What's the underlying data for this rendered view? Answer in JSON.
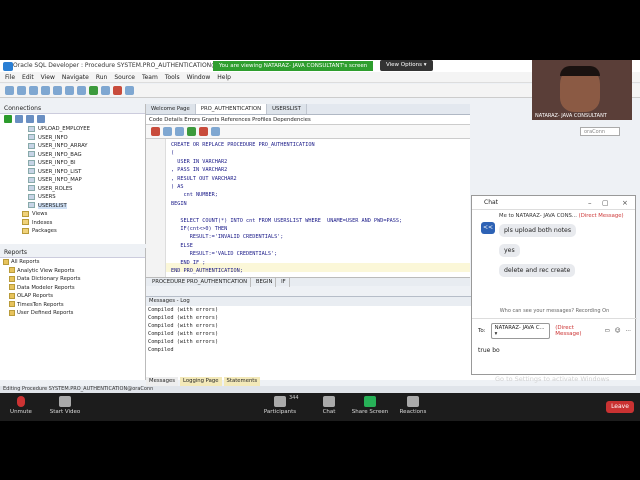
{
  "app": {
    "title": "Oracle SQL Developer : Procedure SYSTEM.PRO_AUTHENTICATION@oraConn",
    "share_banner": "You are viewing NATARAZ- JAVA CONSULTANT's screen",
    "view_options": "View Options ▾"
  },
  "menu": [
    "File",
    "Edit",
    "View",
    "Navigate",
    "Run",
    "Source",
    "Team",
    "Tools",
    "Window",
    "Help"
  ],
  "video_tile": {
    "name": "NATARAZ- JAVA CONSULTANT"
  },
  "connections": {
    "title": "Connections",
    "tables": [
      "UPLOAD_EMPLOYEE",
      "USER_INFO",
      "USER_INFO_ARRAY",
      "USER_INFO_BAG",
      "USER_INFO_BI",
      "USER_INFO_LIST",
      "USER_INFO_MAP",
      "USER_ROLES",
      "USERS",
      "USERSLIST"
    ],
    "selected": "USERSLIST",
    "folders": [
      "Views",
      "Indexes",
      "Packages"
    ]
  },
  "reports": {
    "title": "Reports",
    "items": [
      "All Reports",
      "Analytic View Reports",
      "Data Dictionary Reports",
      "Data Modeler Reports",
      "OLAP Reports",
      "TimesTen Reports",
      "User Defined Reports"
    ]
  },
  "editor": {
    "tabs": [
      "Welcome Page",
      "PRO_AUTHENTICATION",
      "USERSLIST"
    ],
    "active_tab": "PRO_AUTHENTICATION",
    "subtabs": "Code  Details  Errors  Grants  References  Profiles  Dependencies",
    "connection": "oraConn",
    "code": "CREATE OR REPLACE PROCEDURE PRO_AUTHENTICATION\n(\n  USER IN VARCHAR2\n, PASS IN VARCHAR2\n, RESULT OUT VARCHAR2\n) AS\n    cnt NUMBER;\nBEGIN\n\n   SELECT COUNT(*) INTO cnt FROM USERSLIST WHERE  UNAME=USER AND PWD=PASS;\n   IF(cnt<>0) THEN\n      RESULT:='INVALID CREDENTIALS';\n   ELSE\n      RESULT:='VALID CREDENTIALS';\n   END IF ;\nEND PRO_AUTHENTICATION;",
    "breadcrumb": [
      "PROCEDURE PRO_AUTHENTICATION",
      "BEGIN",
      "IF"
    ]
  },
  "messages": {
    "title": "Messages - Log",
    "lines": [
      "Compiled (with errors)",
      "Compiled (with errors)",
      "Compiled (with errors)",
      "Compiled (with errors)",
      "Compiled (with errors)",
      "Compiled"
    ],
    "tabs": [
      "Messages",
      "Logging Page",
      "Statements"
    ]
  },
  "statusbar": "Editing Procedure SYSTEM.PRO_AUTHENTICATION@oraConn",
  "chat": {
    "title": "Chat",
    "to_line": "Me to NATARAZ- JAVA CONS...",
    "direct": "(Direct Message)",
    "avatar": "<<",
    "messages": [
      "pls upload both notes",
      "yes",
      "delete and rec create"
    ],
    "privacy": "Who can see your messages? Recording On",
    "to_label": "To:",
    "recipient": "NATARAZ- JAVA C... ▾",
    "compose_text": "true bo",
    "watermark": "Go to Settings to activate Windows"
  },
  "zoom": {
    "unmute": "Unmute",
    "start_video": "Start Video",
    "participants": "Participants",
    "participant_count": "344",
    "chat": "Chat",
    "share_screen": "Share Screen",
    "reactions": "Reactions",
    "leave": "Leave"
  }
}
